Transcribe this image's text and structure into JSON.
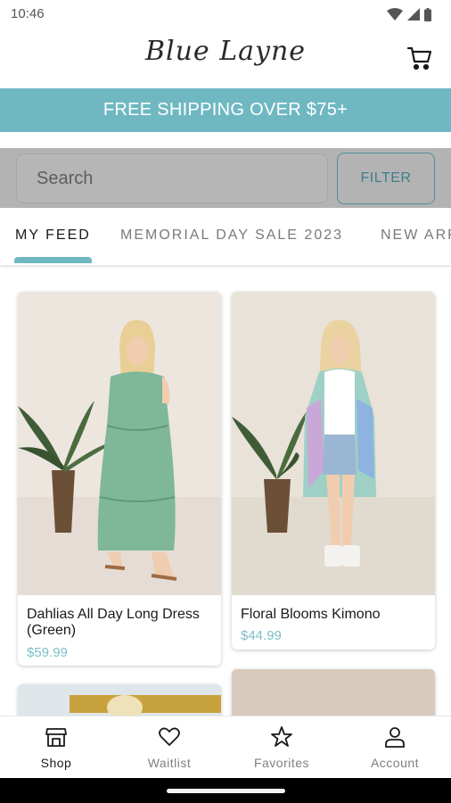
{
  "status_bar": {
    "time": "10:46"
  },
  "header": {
    "logo_text": "Blue Layne",
    "cart_icon": "cart-icon"
  },
  "promo_banner": {
    "text": "FREE SHIPPING OVER $75+",
    "color": "#6fb8c2"
  },
  "search": {
    "placeholder": "Search",
    "filter_label": "FILTER"
  },
  "tabs": [
    {
      "label": "MY FEED",
      "active": true
    },
    {
      "label": "MEMORIAL DAY SALE 2023",
      "active": false
    },
    {
      "label": "NEW ARRIVALS",
      "active": false
    }
  ],
  "products": [
    {
      "name": "Dahlias All Day Long Dress (Green)",
      "price": "$59.99"
    },
    {
      "name": "Floral Blooms Kimono",
      "price": "$44.99"
    }
  ],
  "bottom_nav": [
    {
      "label": "Shop",
      "icon": "shop-icon",
      "active": true
    },
    {
      "label": "Waitlist",
      "icon": "heart-icon",
      "active": false
    },
    {
      "label": "Favorites",
      "icon": "star-icon",
      "active": false
    },
    {
      "label": "Account",
      "icon": "person-icon",
      "active": false
    }
  ],
  "colors": {
    "accent": "#6fb8c2",
    "price": "#7cc0c9",
    "filter_border": "#4e8f9a"
  }
}
